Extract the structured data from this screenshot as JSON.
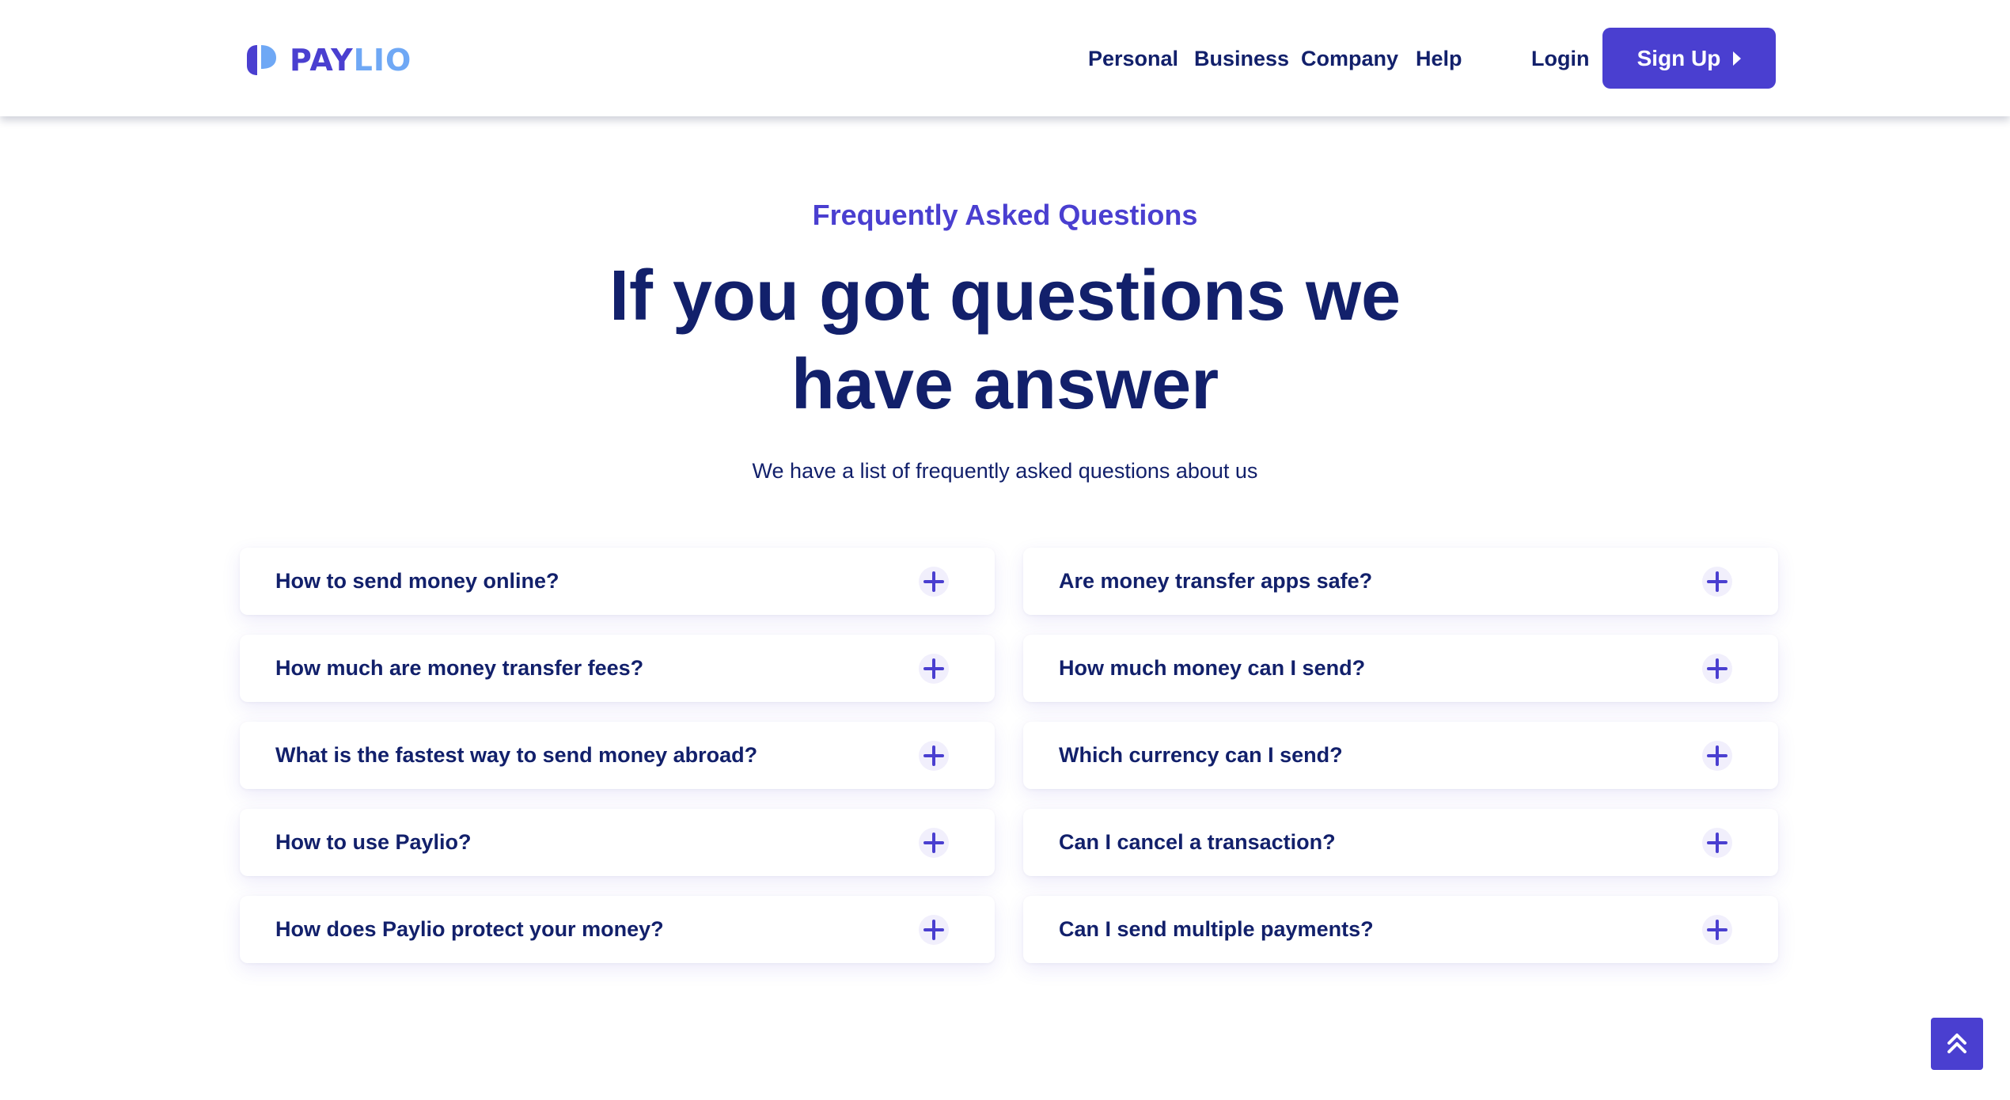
{
  "brand": {
    "name_part1": "PAY",
    "name_part2": "LIO",
    "logo_icon": "paylio-logo-icon",
    "primary_color": "#4a3fd0",
    "accent_color": "#6fa8f5",
    "text_color": "#12206b"
  },
  "nav": {
    "items": [
      {
        "label": "Personal"
      },
      {
        "label": "Business"
      },
      {
        "label": "Company"
      },
      {
        "label": "Help"
      }
    ],
    "login_label": "Login",
    "signup_label": "Sign Up",
    "signup_icon": "caret-right-icon"
  },
  "hero": {
    "eyebrow": "Frequently Asked Questions",
    "headline_line1": "If you got questions we",
    "headline_line2": "have answer",
    "subtext": "We have a list of frequently asked questions about us"
  },
  "faq": {
    "expand_icon": "plus-icon",
    "left": [
      {
        "question": "How to send money online?"
      },
      {
        "question": "How much are money transfer fees?"
      },
      {
        "question": "What is the fastest way to send money abroad?"
      },
      {
        "question": "How to use Paylio?"
      },
      {
        "question": "How does Paylio protect your money?"
      }
    ],
    "right": [
      {
        "question": "Are money transfer apps safe?"
      },
      {
        "question": "How much money can I send?"
      },
      {
        "question": "Which currency can I send?"
      },
      {
        "question": "Can I cancel a transaction?"
      },
      {
        "question": "Can I send multiple payments?"
      }
    ]
  },
  "scroll_top": {
    "icon": "double-chevron-up-icon"
  }
}
